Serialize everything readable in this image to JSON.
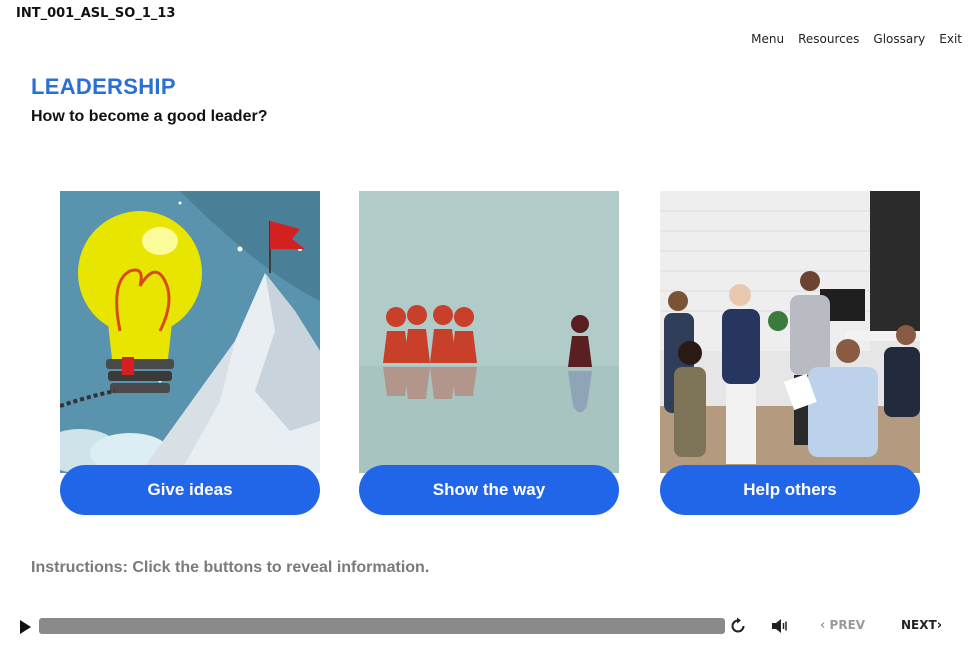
{
  "course_id": "INT_001_ASL_SO_1_13",
  "topnav": {
    "menu": "Menu",
    "resources": "Resources",
    "glossary": "Glossary",
    "exit": "Exit"
  },
  "page_title": "LEADERSHIP",
  "page_subtitle": "How to become a good leader?",
  "cards": [
    {
      "label": "Give ideas",
      "image": "lightbulb-balloon-mountain-flag-illustration"
    },
    {
      "label": "Show the way",
      "image": "red-pawns-following-leader-pawn"
    },
    {
      "label": "Help others",
      "image": "team-meeting-office-photo"
    }
  ],
  "instructions": "Instructions: Click the buttons to reveal information.",
  "player": {
    "prev_label": "PREV",
    "next_label": "NEXT",
    "prev_chevron": "‹",
    "next_chevron": "›"
  },
  "colors": {
    "accent": "#2166e8",
    "title": "#2a6fd8",
    "instructions": "#7a7a7a",
    "progress_bar": "#8a8a8a"
  }
}
